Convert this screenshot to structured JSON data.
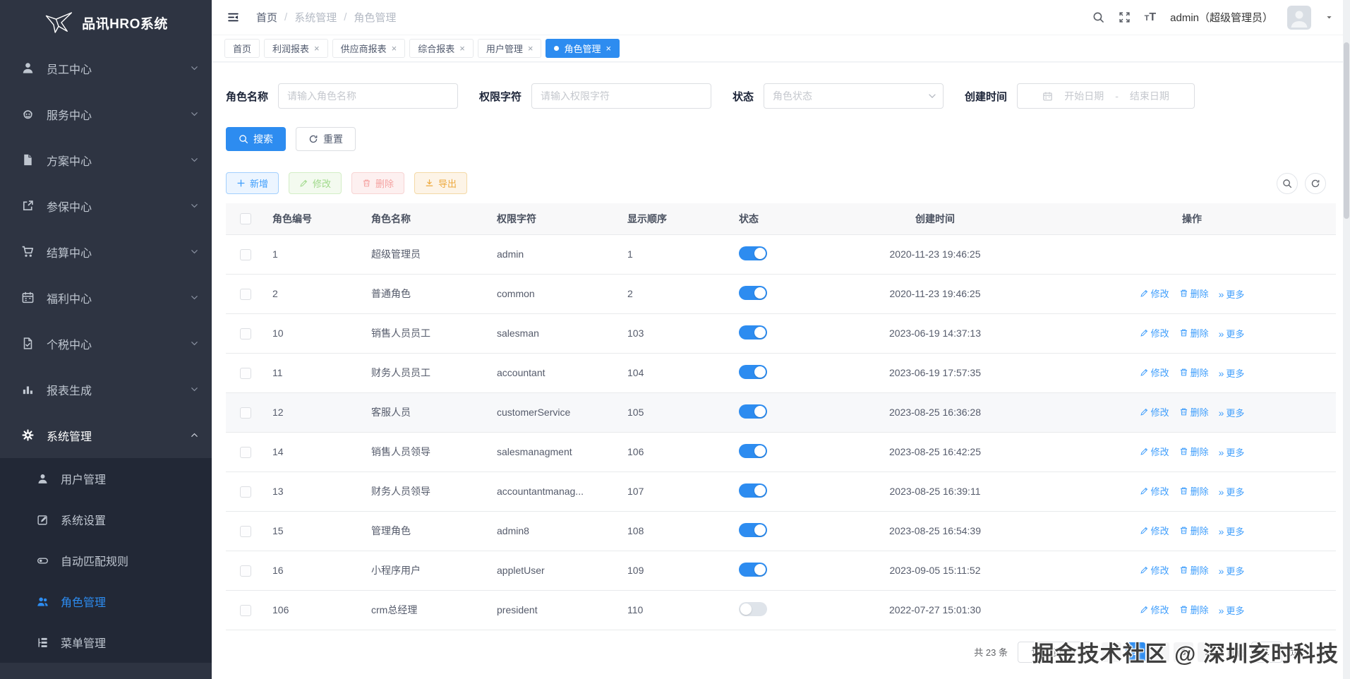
{
  "app": {
    "title": "品讯HRO系统"
  },
  "colors": {
    "accent": "#2d8cf0",
    "sidebar_bg": "#2e3442",
    "submenu_bg": "#222836",
    "switch_off": "#dfe4ea"
  },
  "header": {
    "breadcrumb": [
      "首页",
      "系统管理",
      "角色管理"
    ],
    "separator": "/",
    "user": "admin（超级管理员）"
  },
  "sidebar": {
    "items": [
      {
        "key": "employee-center",
        "label": "员工中心",
        "icon": "user-icon"
      },
      {
        "key": "service-center",
        "label": "服务中心",
        "icon": "service-icon"
      },
      {
        "key": "plan-center",
        "label": "方案中心",
        "icon": "document-icon"
      },
      {
        "key": "insurance-center",
        "label": "参保中心",
        "icon": "external-link-icon"
      },
      {
        "key": "settlement-center",
        "label": "结算中心",
        "icon": "cart-icon"
      },
      {
        "key": "welfare-center",
        "label": "福利中心",
        "icon": "calendar-icon"
      },
      {
        "key": "tax-center",
        "label": "个税中心",
        "icon": "tax-doc-icon"
      },
      {
        "key": "report-center",
        "label": "报表生成",
        "icon": "bar-chart-icon"
      },
      {
        "key": "system-management",
        "label": "系统管理",
        "icon": "gear-icon",
        "expanded": true,
        "children": [
          {
            "key": "user-management",
            "label": "用户管理",
            "icon": "user-icon"
          },
          {
            "key": "system-settings",
            "label": "系统设置",
            "icon": "edit-square-icon"
          },
          {
            "key": "auto-match-rules",
            "label": "自动匹配规则",
            "icon": "toggle-icon"
          },
          {
            "key": "role-management",
            "label": "角色管理",
            "icon": "users-icon",
            "active": true
          },
          {
            "key": "menu-management",
            "label": "菜单管理",
            "icon": "menu-tree-icon"
          }
        ]
      }
    ]
  },
  "tabs": [
    {
      "label": "首页",
      "closable": false
    },
    {
      "label": "利润报表",
      "closable": true
    },
    {
      "label": "供应商报表",
      "closable": true
    },
    {
      "label": "综合报表",
      "closable": true
    },
    {
      "label": "用户管理",
      "closable": true
    },
    {
      "label": "角色管理",
      "closable": true,
      "active": true
    }
  ],
  "filters": {
    "role_name": {
      "label": "角色名称",
      "placeholder": "请输入角色名称"
    },
    "perm_key": {
      "label": "权限字符",
      "placeholder": "请输入权限字符"
    },
    "status": {
      "label": "状态",
      "placeholder": "角色状态"
    },
    "create_time": {
      "label": "创建时间",
      "start_placeholder": "开始日期",
      "separator": "-",
      "end_placeholder": "结束日期"
    }
  },
  "actions": {
    "search": "搜索",
    "reset": "重置"
  },
  "toolbar": {
    "buttons": [
      {
        "label": "新增",
        "icon": "plus-icon",
        "type": "add"
      },
      {
        "label": "修改",
        "icon": "pencil-icon",
        "type": "edit"
      },
      {
        "label": "删除",
        "icon": "trash-icon",
        "type": "delete"
      },
      {
        "label": "导出",
        "icon": "download-icon",
        "type": "export"
      }
    ],
    "right_icons": [
      "search-icon",
      "refresh-icon"
    ]
  },
  "table": {
    "columns": [
      "角色编号",
      "角色名称",
      "权限字符",
      "显示顺序",
      "状态",
      "创建时间",
      "操作"
    ],
    "row_actions": [
      {
        "label": "修改",
        "icon": "pencil-icon"
      },
      {
        "label": "删除",
        "icon": "trash-icon"
      },
      {
        "label": "更多",
        "icon": "double-right-icon"
      }
    ],
    "rows": [
      {
        "id": "1",
        "name": "超级管理员",
        "perm": "admin",
        "order": "1",
        "status": true,
        "created": "2020-11-23 19:46:25",
        "actions": false
      },
      {
        "id": "2",
        "name": "普通角色",
        "perm": "common",
        "order": "2",
        "status": true,
        "created": "2020-11-23 19:46:25",
        "actions": true
      },
      {
        "id": "10",
        "name": "销售人员员工",
        "perm": "salesman",
        "order": "103",
        "status": true,
        "created": "2023-06-19 14:37:13",
        "actions": true
      },
      {
        "id": "11",
        "name": "财务人员员工",
        "perm": "accountant",
        "order": "104",
        "status": true,
        "created": "2023-06-19 17:57:35",
        "actions": true
      },
      {
        "id": "12",
        "name": "客服人员",
        "perm": "customerService",
        "order": "105",
        "status": true,
        "created": "2023-08-25 16:36:28",
        "actions": true,
        "hover": true
      },
      {
        "id": "14",
        "name": "销售人员领导",
        "perm": "salesmanagment",
        "order": "106",
        "status": true,
        "created": "2023-08-25 16:42:25",
        "actions": true
      },
      {
        "id": "13",
        "name": "财务人员领导",
        "perm": "accountantmanag...",
        "order": "107",
        "status": true,
        "created": "2023-08-25 16:39:11",
        "actions": true
      },
      {
        "id": "15",
        "name": "管理角色",
        "perm": "admin8",
        "order": "108",
        "status": true,
        "created": "2023-08-25 16:54:39",
        "actions": true
      },
      {
        "id": "16",
        "name": "小程序用户",
        "perm": "appletUser",
        "order": "109",
        "status": true,
        "created": "2023-09-05 15:11:52",
        "actions": true
      },
      {
        "id": "106",
        "name": "crm总经理",
        "perm": "president",
        "order": "110",
        "status": false,
        "created": "2022-07-27 15:01:30",
        "actions": true
      }
    ]
  },
  "pagination": {
    "total": "共 23 条",
    "page_size": "10条/页",
    "pages": [
      "1",
      "2",
      "3"
    ],
    "active_page": "1",
    "goto_label": "前往",
    "goto_value": "1",
    "page_unit": "页"
  },
  "watermark": "掘金技术社区 @ 深圳亥时科技"
}
